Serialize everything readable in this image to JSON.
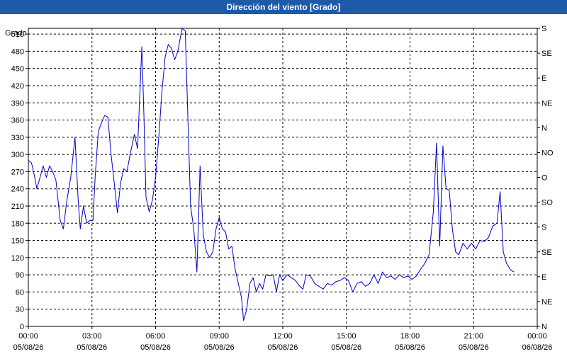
{
  "window": {
    "title": "Dirección del viento [Grado]"
  },
  "chart_data": {
    "type": "line",
    "title": "Dirección del viento [Grado]",
    "ylabel": "Grado",
    "ylim": [
      0,
      520
    ],
    "yticks": [
      0,
      30,
      60,
      90,
      120,
      150,
      180,
      210,
      240,
      270,
      300,
      330,
      360,
      390,
      420,
      450,
      480,
      510
    ],
    "right_ticks": [
      {
        "value": 0,
        "label": "N"
      },
      {
        "value": 45,
        "label": "NE"
      },
      {
        "value": 90,
        "label": "E"
      },
      {
        "value": 135,
        "label": "SE"
      },
      {
        "value": 180,
        "label": "S"
      },
      {
        "value": 225,
        "label": "SO"
      },
      {
        "value": 270,
        "label": "O"
      },
      {
        "value": 315,
        "label": "NO"
      },
      {
        "value": 360,
        "label": "N"
      },
      {
        "value": 405,
        "label": "NE"
      },
      {
        "value": 450,
        "label": "E"
      },
      {
        "value": 495,
        "label": "SE"
      },
      {
        "value": 540,
        "label": "S"
      }
    ],
    "xlim": [
      0,
      24
    ],
    "xticks": [
      {
        "value": 0,
        "time": "00:00",
        "date": "05/08/26"
      },
      {
        "value": 3,
        "time": "03:00",
        "date": "05/08/26"
      },
      {
        "value": 6,
        "time": "06:00",
        "date": "05/08/26"
      },
      {
        "value": 9,
        "time": "09:00",
        "date": "05/08/26"
      },
      {
        "value": 12,
        "time": "12:00",
        "date": "05/08/26"
      },
      {
        "value": 15,
        "time": "15:00",
        "date": "05/08/26"
      },
      {
        "value": 18,
        "time": "18:00",
        "date": "05/08/26"
      },
      {
        "value": 21,
        "time": "21:00",
        "date": "05/08/26"
      },
      {
        "value": 24,
        "time": "00:00",
        "date": "06/08/26"
      }
    ],
    "grid": true,
    "colors": {
      "line": "#0000cc",
      "grid": "#000000",
      "title_bar": "#1d5aa8"
    },
    "series": [
      {
        "points": [
          [
            0.0,
            290
          ],
          [
            0.15,
            285
          ],
          [
            0.3,
            260
          ],
          [
            0.4,
            240
          ],
          [
            0.55,
            260
          ],
          [
            0.7,
            280
          ],
          [
            0.85,
            260
          ],
          [
            1.0,
            280
          ],
          [
            1.15,
            270
          ],
          [
            1.3,
            255
          ],
          [
            1.5,
            185
          ],
          [
            1.65,
            170
          ],
          [
            1.8,
            215
          ],
          [
            2.0,
            260
          ],
          [
            2.2,
            330
          ],
          [
            2.35,
            220
          ],
          [
            2.45,
            170
          ],
          [
            2.6,
            210
          ],
          [
            2.75,
            180
          ],
          [
            2.9,
            185
          ],
          [
            3.05,
            185
          ],
          [
            3.15,
            260
          ],
          [
            3.3,
            340
          ],
          [
            3.45,
            355
          ],
          [
            3.6,
            368
          ],
          [
            3.75,
            365
          ],
          [
            3.9,
            300
          ],
          [
            4.05,
            250
          ],
          [
            4.2,
            198
          ],
          [
            4.35,
            250
          ],
          [
            4.5,
            275
          ],
          [
            4.65,
            270
          ],
          [
            4.8,
            300
          ],
          [
            5.0,
            335
          ],
          [
            5.15,
            310
          ],
          [
            5.35,
            488
          ],
          [
            5.45,
            370
          ],
          [
            5.55,
            225
          ],
          [
            5.7,
            200
          ],
          [
            5.85,
            220
          ],
          [
            6.0,
            260
          ],
          [
            6.15,
            330
          ],
          [
            6.3,
            410
          ],
          [
            6.45,
            470
          ],
          [
            6.6,
            492
          ],
          [
            6.75,
            485
          ],
          [
            6.9,
            465
          ],
          [
            7.05,
            480
          ],
          [
            7.25,
            520
          ],
          [
            7.4,
            515
          ],
          [
            7.55,
            330
          ],
          [
            7.65,
            210
          ],
          [
            7.8,
            170
          ],
          [
            7.95,
            95
          ],
          [
            8.1,
            280
          ],
          [
            8.25,
            160
          ],
          [
            8.4,
            130
          ],
          [
            8.55,
            120
          ],
          [
            8.7,
            130
          ],
          [
            8.85,
            170
          ],
          [
            9.0,
            190
          ],
          [
            9.15,
            170
          ],
          [
            9.3,
            165
          ],
          [
            9.45,
            135
          ],
          [
            9.6,
            140
          ],
          [
            9.75,
            100
          ],
          [
            9.9,
            75
          ],
          [
            10.05,
            50
          ],
          [
            10.15,
            10
          ],
          [
            10.3,
            30
          ],
          [
            10.45,
            75
          ],
          [
            10.6,
            85
          ],
          [
            10.75,
            60
          ],
          [
            10.9,
            75
          ],
          [
            11.05,
            65
          ],
          [
            11.2,
            90
          ],
          [
            11.4,
            88
          ],
          [
            11.55,
            90
          ],
          [
            11.7,
            60
          ],
          [
            11.85,
            90
          ],
          [
            12.0,
            80
          ],
          [
            12.2,
            90
          ],
          [
            12.4,
            85
          ],
          [
            12.6,
            80
          ],
          [
            12.8,
            70
          ],
          [
            12.95,
            65
          ],
          [
            13.1,
            90
          ],
          [
            13.3,
            88
          ],
          [
            13.5,
            75
          ],
          [
            13.7,
            70
          ],
          [
            13.9,
            65
          ],
          [
            14.1,
            75
          ],
          [
            14.3,
            72
          ],
          [
            14.5,
            78
          ],
          [
            14.7,
            80
          ],
          [
            14.9,
            85
          ],
          [
            15.1,
            80
          ],
          [
            15.3,
            60
          ],
          [
            15.5,
            75
          ],
          [
            15.7,
            78
          ],
          [
            15.9,
            70
          ],
          [
            16.1,
            75
          ],
          [
            16.3,
            90
          ],
          [
            16.5,
            75
          ],
          [
            16.7,
            95
          ],
          [
            16.9,
            85
          ],
          [
            17.1,
            88
          ],
          [
            17.3,
            82
          ],
          [
            17.5,
            90
          ],
          [
            17.7,
            85
          ],
          [
            17.9,
            88
          ],
          [
            18.1,
            82
          ],
          [
            18.3,
            88
          ],
          [
            18.5,
            100
          ],
          [
            18.7,
            110
          ],
          [
            18.9,
            125
          ],
          [
            19.1,
            200
          ],
          [
            19.25,
            320
          ],
          [
            19.4,
            140
          ],
          [
            19.55,
            315
          ],
          [
            19.7,
            240
          ],
          [
            19.85,
            238
          ],
          [
            20.0,
            170
          ],
          [
            20.15,
            130
          ],
          [
            20.3,
            125
          ],
          [
            20.5,
            145
          ],
          [
            20.7,
            135
          ],
          [
            20.9,
            145
          ],
          [
            21.1,
            135
          ],
          [
            21.3,
            150
          ],
          [
            21.5,
            148
          ],
          [
            21.7,
            155
          ],
          [
            21.9,
            175
          ],
          [
            22.1,
            180
          ],
          [
            22.25,
            235
          ],
          [
            22.4,
            130
          ],
          [
            22.55,
            110
          ],
          [
            22.75,
            98
          ],
          [
            22.9,
            95
          ]
        ]
      }
    ]
  }
}
